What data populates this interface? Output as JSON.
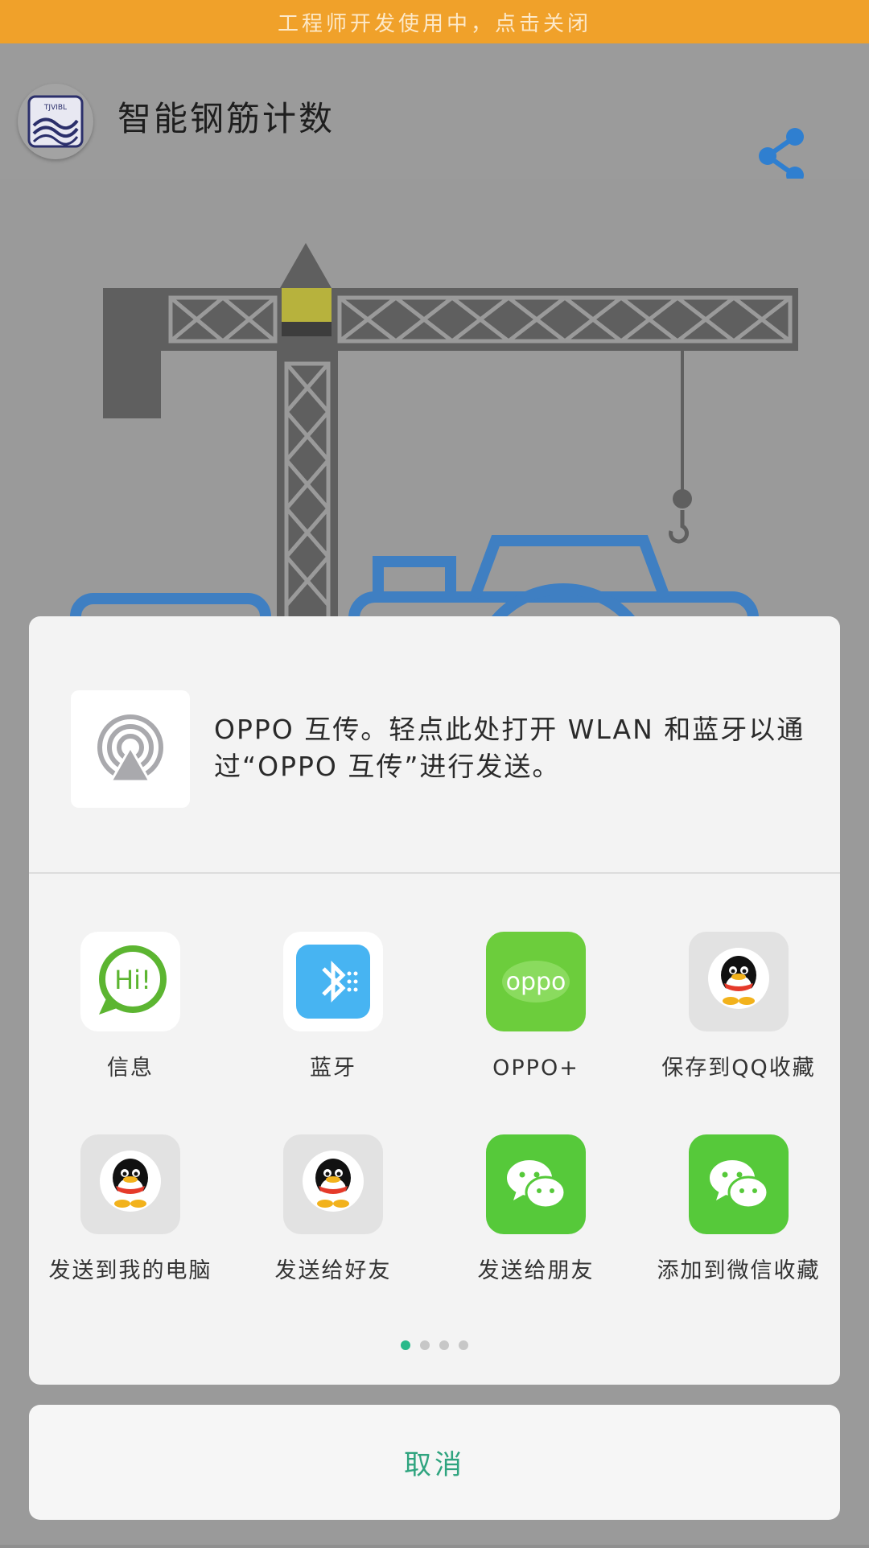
{
  "banner": {
    "text": "工程师开发使用中，点击关闭"
  },
  "appbar": {
    "title": "智能钢筋计数",
    "logo_text": "TJVIBL"
  },
  "share_sheet": {
    "transfer": {
      "text": "OPPO 互传。轻点此处打开 WLAN 和蓝牙以通过“OPPO 互传”进行发送。"
    },
    "apps": [
      {
        "label": "信息",
        "icon": "message-hi-icon",
        "bubble_text": "Hi!"
      },
      {
        "label": "蓝牙",
        "icon": "bluetooth-icon"
      },
      {
        "label": "OPPO+",
        "icon": "oppo-icon",
        "icon_text": "oppo"
      },
      {
        "label": "保存到QQ收藏",
        "icon": "qq-icon"
      },
      {
        "label": "发送到我的电脑",
        "icon": "qq-icon"
      },
      {
        "label": "发送给好友",
        "icon": "qq-icon"
      },
      {
        "label": "发送给朋友",
        "icon": "wechat-icon"
      },
      {
        "label": "添加到微信收藏",
        "icon": "wechat-icon"
      }
    ],
    "page_indicator": {
      "count": 4,
      "active": 1
    },
    "cancel_label": "取消"
  },
  "colors": {
    "banner": "#f0a12a",
    "accent_green": "#2fa47f",
    "share_icon_blue": "#2f7fd0",
    "wechat_green": "#56c93a",
    "bluetooth_blue": "#47b4f2"
  }
}
